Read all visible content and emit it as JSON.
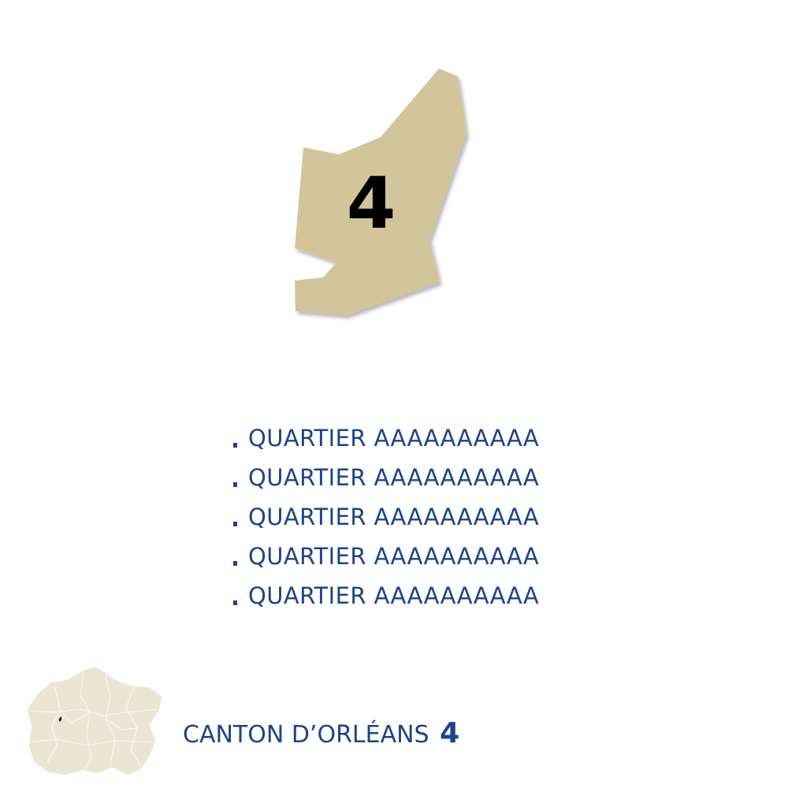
{
  "canton": {
    "number": "4",
    "title_prefix": "CANTON D’ORLÉANS",
    "title_number": "4"
  },
  "quartiers": [
    "QUARTIER AAAAAAAAAA",
    "QUARTIER AAAAAAAAAA",
    "QUARTIER AAAAAAAAAA",
    "QUARTIER AAAAAAAAAA",
    "QUARTIER AAAAAAAAAA"
  ],
  "colors": {
    "canton_fill": "#d3c59b",
    "text_blue": "#1c4488",
    "locator_fill": "#ede5d3"
  }
}
